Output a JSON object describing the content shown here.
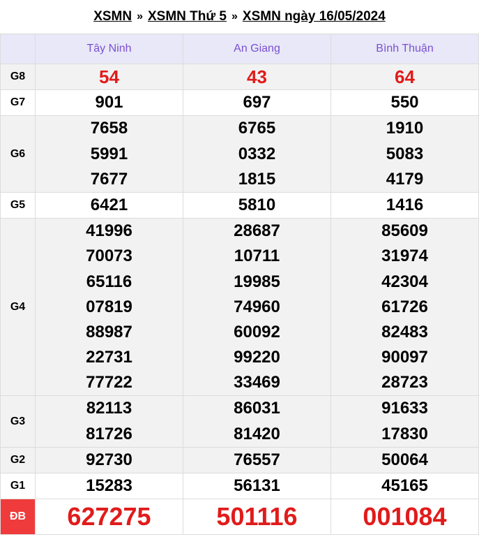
{
  "breadcrumb": {
    "items": [
      "XSMN",
      "XSMN Thứ 5",
      "XSMN ngày 16/05/2024"
    ],
    "separator": "»"
  },
  "provinces": [
    "Tây Ninh",
    "An Giang",
    "Bình Thuận"
  ],
  "prizes": [
    {
      "label": "G8",
      "results": [
        [
          "54"
        ],
        [
          "43"
        ],
        [
          "64"
        ]
      ]
    },
    {
      "label": "G7",
      "results": [
        [
          "901"
        ],
        [
          "697"
        ],
        [
          "550"
        ]
      ]
    },
    {
      "label": "G6",
      "results": [
        [
          "7658",
          "5991",
          "7677"
        ],
        [
          "6765",
          "0332",
          "1815"
        ],
        [
          "1910",
          "5083",
          "4179"
        ]
      ]
    },
    {
      "label": "G5",
      "results": [
        [
          "6421"
        ],
        [
          "5810"
        ],
        [
          "1416"
        ]
      ]
    },
    {
      "label": "G4",
      "results": [
        [
          "41996",
          "70073",
          "65116",
          "07819",
          "88987",
          "22731",
          "77722"
        ],
        [
          "28687",
          "10711",
          "19985",
          "74960",
          "60092",
          "99220",
          "33469"
        ],
        [
          "85609",
          "31974",
          "42304",
          "61726",
          "82483",
          "90097",
          "28723"
        ]
      ]
    },
    {
      "label": "G3",
      "results": [
        [
          "82113",
          "81726"
        ],
        [
          "86031",
          "81420"
        ],
        [
          "91633",
          "17830"
        ]
      ]
    },
    {
      "label": "G2",
      "results": [
        [
          "92730"
        ],
        [
          "76557"
        ],
        [
          "50064"
        ]
      ]
    },
    {
      "label": "G1",
      "results": [
        [
          "15283"
        ],
        [
          "56131"
        ],
        [
          "45165"
        ]
      ]
    },
    {
      "label": "ĐB",
      "results": [
        [
          "627275"
        ],
        [
          "501116"
        ],
        [
          "001084"
        ]
      ]
    }
  ],
  "colors": {
    "header_bg": "#e8e8f8",
    "header_text": "#7b4fd1",
    "prize_red": "#e11b1b",
    "special_label_bg": "#ef3b3b",
    "row_shade": "#f2f2f2"
  }
}
